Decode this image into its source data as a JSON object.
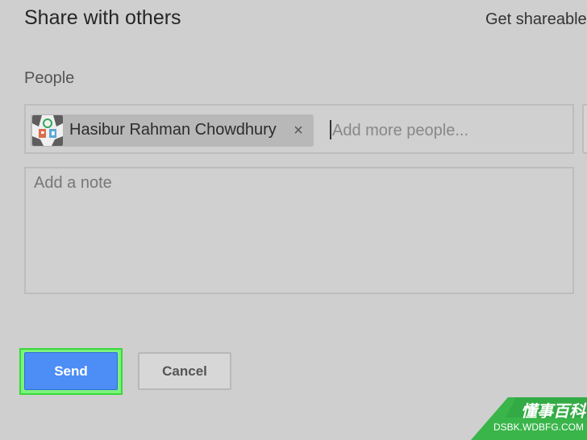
{
  "dialog": {
    "title": "Share with others",
    "shareable_link_label": "Get shareable"
  },
  "people": {
    "label": "People",
    "chip": {
      "name": "Hasibur Rahman Chowdhury",
      "remove_glyph": "×"
    },
    "input": {
      "placeholder": "Add more people..."
    }
  },
  "note": {
    "placeholder": "Add a note"
  },
  "actions": {
    "send_label": "Send",
    "cancel_label": "Cancel"
  },
  "watermark": {
    "text_cn": "懂事百科",
    "domain": "DSBK.WDBFG.COM"
  },
  "colors": {
    "background": "#cfcfcf",
    "send_button": "#4c8df6",
    "send_highlight": "#7cf27c",
    "watermark_green": "#39b54a"
  },
  "icons": {
    "avatar": "profile-image",
    "chip_remove": "close-icon"
  }
}
